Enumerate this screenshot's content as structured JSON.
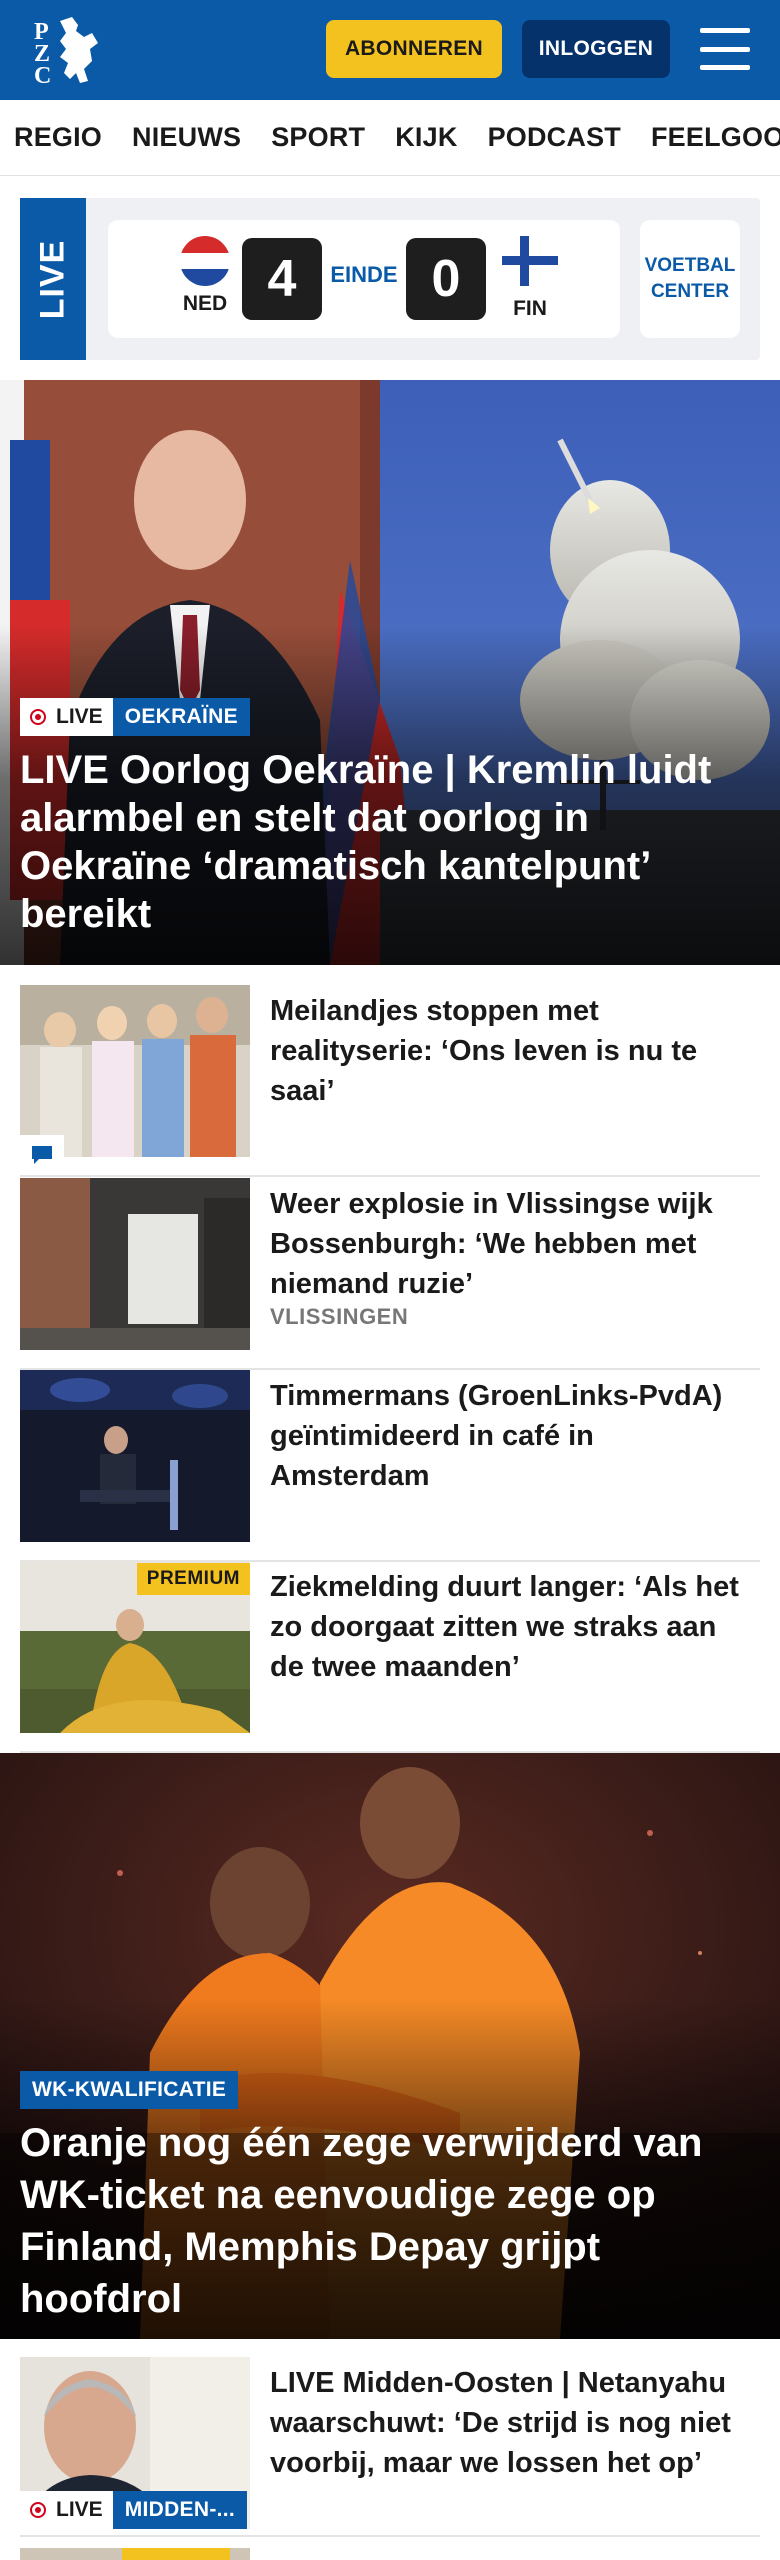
{
  "header": {
    "logo_label": "PZC",
    "subscribe_label": "ABONNEREN",
    "login_label": "INLOGGEN",
    "brand_color": "#0a5aa8",
    "accent_color": "#f4c21f"
  },
  "nav": {
    "items": [
      "REGIO",
      "NIEUWS",
      "SPORT",
      "KIJK",
      "PODCAST",
      "FEELGOOD"
    ]
  },
  "live_score": {
    "live_label": "LIVE",
    "home": {
      "code": "NED",
      "score": "4"
    },
    "status": "EINDE",
    "away": {
      "code": "FIN",
      "score": "0"
    },
    "voetbal_center_label": "VOETBAL CENTER"
  },
  "hero": {
    "live_label": "LIVE",
    "category": "OEKRAÏNE",
    "title": "LIVE Oorlog Oekraïne | Kremlin luidt alarmbel en stelt dat oorlog in Oekraïne ‘dramatisch kantelpunt’ bereikt"
  },
  "articles": [
    {
      "title": "Meilandjes stoppen met realityserie: ‘Ons leven is nu te saai’",
      "has_comments": true
    },
    {
      "title": "Weer explosie in Vlissingse wijk Bossenburgh: ‘We hebben met niemand ruzie’",
      "location": "VLISSINGEN"
    },
    {
      "title": "Timmermans (GroenLinks-PvdA) geïntimideerd in café in Amsterdam"
    },
    {
      "title": "Ziekmelding duurt langer: ‘Als het zo doorgaat zitten we straks aan de twee maanden’",
      "badge": "PREMIUM"
    }
  ],
  "hero2": {
    "category": "WK-KWALIFICATIE",
    "title": "Oranje nog één zege verwijderd van WK-ticket na eenvoudige zege op Finland, Memphis Depay grijpt hoofdrol"
  },
  "article_bottom": {
    "live_label": "LIVE",
    "category": "MIDDEN-...",
    "title": "LIVE Midden-Oosten | Netanyahu waarschuwt: ‘De strijd is nog niet voorbij, maar we lossen het op’"
  }
}
